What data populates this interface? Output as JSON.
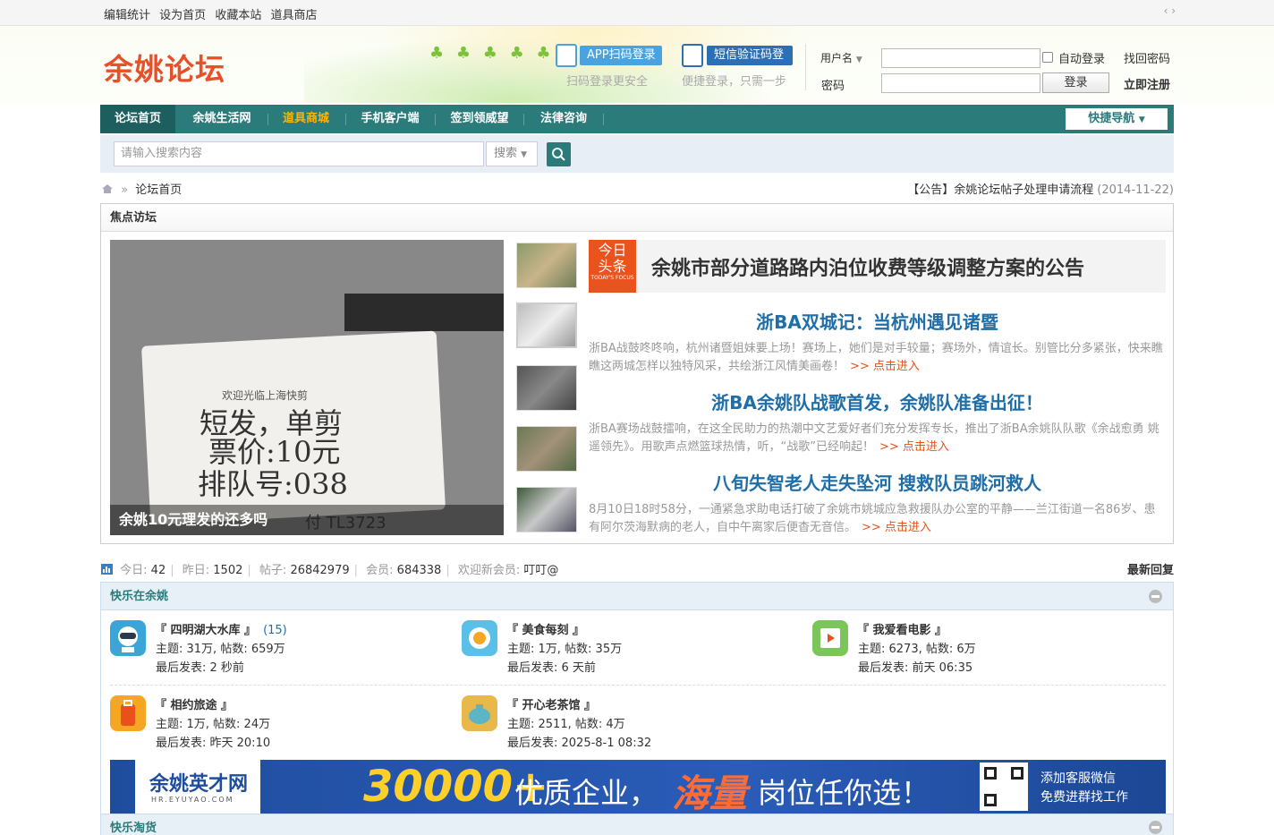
{
  "topbar": {
    "links": [
      "编辑统计",
      "设为首页",
      "收藏本站",
      "道具商店"
    ],
    "arrows": "‹ ›"
  },
  "header": {
    "logo": "余姚论坛",
    "app_login": "APP扫码登录",
    "app_sub": "扫码登录更安全",
    "sms_login": "短信验证码登录",
    "sms_sub": "便捷登录，只需一步",
    "username_label": "用户名",
    "password_label": "密码",
    "auto_login": "自动登录",
    "forgot": "找回密码",
    "login_btn": "登录",
    "register": "立即注册"
  },
  "nav": {
    "items": [
      "论坛首页",
      "余姚生活网",
      "道具商城",
      "手机客户端",
      "签到领威望",
      "法律咨询"
    ],
    "quick": "快捷导航"
  },
  "search": {
    "placeholder": "请输入搜索内容",
    "select": "搜索"
  },
  "breadcrumb": {
    "sep": "»",
    "current": "论坛首页"
  },
  "notice": {
    "text": "【公告】余姚论坛帖子处理申请流程",
    "date": "(2014-11-22)"
  },
  "focus": {
    "title": "焦点访坛",
    "main_caption": "余姚10元理发的还多吗",
    "ticket": {
      "top": "欢迎光临上海快剪",
      "l1": "短发，单剪",
      "l2": "票价:10元",
      "l3": "排队号:038",
      "l4": "付 TL3723"
    },
    "today_tag": {
      "t1": "今日",
      "t2": "头条",
      "t3": "TODAY'S FOCUS"
    },
    "headline": "余姚市部分道路路内泊位收费等级调整方案的公告",
    "stories": [
      {
        "title": "浙BA双城记：当杭州遇见诸暨",
        "desc": "浙BA战鼓咚咚响，杭州诸暨姐妹要上场！赛场上，她们是对手较量；赛场外，情谊长。别管比分多紧张，快来瞧瞧这两城怎样以独特风采，共绘浙江风情美画卷！",
        "more": ">> 点击进入"
      },
      {
        "title": "浙BA余姚队战歌首发，余姚队准备出征！",
        "desc": "浙BA赛场战鼓擂响，在这全民助力的热潮中文艺爱好者们充分发挥专长，推出了浙BA余姚队队歌《余战愈勇 姚遥领先》。用歌声点燃篮球热情，听，“战歌”已经响起！",
        "more": ">> 点击进入"
      },
      {
        "title": "八旬失智老人走失坠河 搜救队员跳河救人",
        "desc": "8月10日18时58分，一通紧急求助电话打破了余姚市姚城应急救援队办公室的平静——兰江街道一名86岁、患有阿尔茨海默病的老人，自中午离家后便杳无音信。",
        "more": ">> 点击进入"
      }
    ]
  },
  "stats": {
    "today_label": "今日:",
    "today": "42",
    "yesterday_label": "昨日:",
    "yesterday": "1502",
    "posts_label": "帖子:",
    "posts": "26842979",
    "members_label": "会员:",
    "members": "684338",
    "welcome_label": "欢迎新会员:",
    "welcome": "叮叮@",
    "latest": "最新回复"
  },
  "category": {
    "title": "快乐在余姚",
    "forums": [
      {
        "name": "『 四明湖大水库 』",
        "today": "(15)",
        "meta": "主题: 31万, 帖数: 659万",
        "last": "最后发表: 2 秒前",
        "color": "#3aa6d8"
      },
      {
        "name": "『 美食每刻 』",
        "today": "",
        "meta": "主题: 1万, 帖数: 35万",
        "last": "最后发表: 6 天前",
        "color": "#5bc0e8"
      },
      {
        "name": "『 我爱看电影 』",
        "today": "",
        "meta": "主题: 6273, 帖数: 6万",
        "last": "最后发表: 前天 06:35",
        "color": "#7cc55a"
      },
      {
        "name": "『 相约旅途 』",
        "today": "",
        "meta": "主题: 1万, 帖数: 24万",
        "last": "最后发表: 昨天 20:10",
        "color": "#f5a623"
      },
      {
        "name": "『 开心老茶馆 』",
        "today": "",
        "meta": "主题: 2511, 帖数: 4万",
        "last": "最后发表: 2025-8-1 08:32",
        "color": "#e8b94a"
      }
    ]
  },
  "banner": {
    "logo": "余姚英才网",
    "logo_url": "HR.EYUYAO.COM",
    "num": "30000+",
    "t1": "优质企业，",
    "t2": "海量",
    "t3": "岗位任你选！",
    "w1": "添加客服微信",
    "w2": "免费进群找工作"
  },
  "category2": {
    "title": "快乐淘货"
  }
}
